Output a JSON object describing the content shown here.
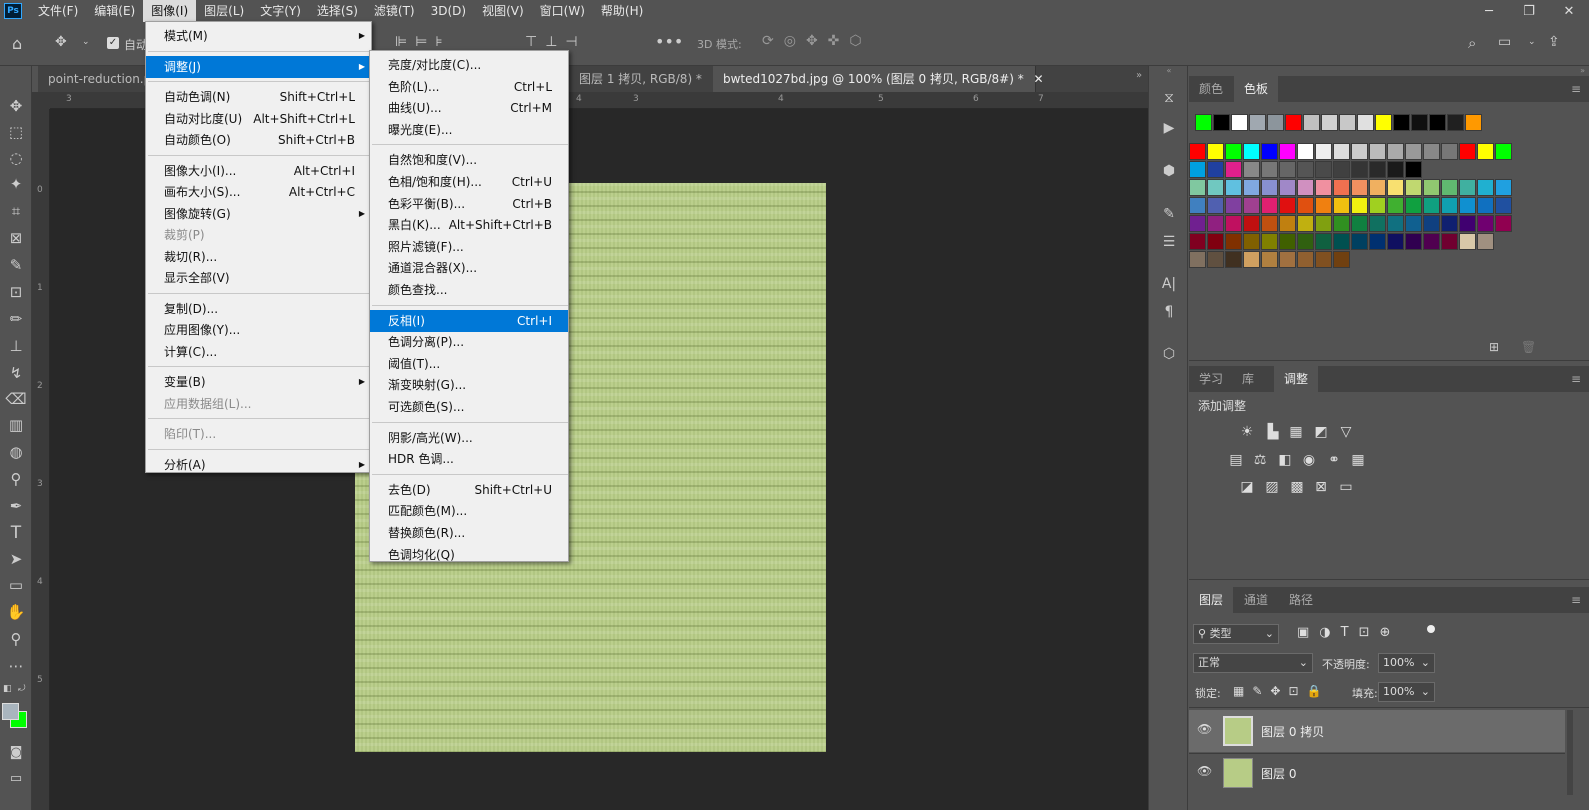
{
  "app": {
    "logo": "Ps"
  },
  "menubar": {
    "items": [
      "文件(F)",
      "编辑(E)",
      "图像(I)",
      "图层(L)",
      "文字(Y)",
      "选择(S)",
      "滤镜(T)",
      "3D(D)",
      "视图(V)",
      "窗口(W)",
      "帮助(H)"
    ],
    "active_index": 2
  },
  "options_bar": {
    "auto_select_label": "自动",
    "mode_3d_label": "3D 模式:"
  },
  "tabs": [
    {
      "label": "point-reduction.p",
      "active": false
    },
    {
      "label": "图层 1 拷贝, RGB/8) *",
      "active": false
    },
    {
      "label": "bwted1027bd.jpg @ 100% (图层 0 拷贝, RGB/8#) *",
      "active": true
    }
  ],
  "ruler": {
    "top": [
      "3",
      "4",
      "5",
      "6",
      "7"
    ],
    "top_visible": [
      "3",
      "4",
      "3",
      "4",
      "5",
      "6",
      "7"
    ],
    "left": [
      "0",
      "1",
      "2",
      "3",
      "4",
      "5"
    ]
  },
  "image_menu": {
    "items": [
      {
        "label": "模式(M)",
        "shortcut": "",
        "submenu": true,
        "disabled": false
      },
      {
        "separator": true
      },
      {
        "label": "调整(J)",
        "shortcut": "",
        "submenu": true,
        "disabled": false,
        "highlighted": true
      },
      {
        "separator": true
      },
      {
        "label": "自动色调(N)",
        "shortcut": "Shift+Ctrl+L"
      },
      {
        "label": "自动对比度(U)",
        "shortcut": "Alt+Shift+Ctrl+L"
      },
      {
        "label": "自动颜色(O)",
        "shortcut": "Shift+Ctrl+B"
      },
      {
        "separator": true
      },
      {
        "label": "图像大小(I)...",
        "shortcut": "Alt+Ctrl+I"
      },
      {
        "label": "画布大小(S)...",
        "shortcut": "Alt+Ctrl+C"
      },
      {
        "label": "图像旋转(G)",
        "shortcut": "",
        "submenu": true
      },
      {
        "label": "裁剪(P)",
        "shortcut": "",
        "disabled": true
      },
      {
        "label": "裁切(R)...",
        "shortcut": ""
      },
      {
        "label": "显示全部(V)",
        "shortcut": ""
      },
      {
        "separator": true
      },
      {
        "label": "复制(D)...",
        "shortcut": ""
      },
      {
        "label": "应用图像(Y)...",
        "shortcut": ""
      },
      {
        "label": "计算(C)...",
        "shortcut": ""
      },
      {
        "separator": true
      },
      {
        "label": "变量(B)",
        "shortcut": "",
        "submenu": true
      },
      {
        "label": "应用数据组(L)...",
        "shortcut": "",
        "disabled": true
      },
      {
        "separator": true
      },
      {
        "label": "陷印(T)...",
        "shortcut": "",
        "disabled": true
      },
      {
        "separator": true
      },
      {
        "label": "分析(A)",
        "shortcut": "",
        "submenu": true
      }
    ]
  },
  "adjust_menu": {
    "items": [
      {
        "label": "亮度/对比度(C)...",
        "shortcut": ""
      },
      {
        "label": "色阶(L)...",
        "shortcut": "Ctrl+L"
      },
      {
        "label": "曲线(U)...",
        "shortcut": "Ctrl+M"
      },
      {
        "label": "曝光度(E)...",
        "shortcut": ""
      },
      {
        "separator": true
      },
      {
        "label": "自然饱和度(V)...",
        "shortcut": ""
      },
      {
        "label": "色相/饱和度(H)...",
        "shortcut": "Ctrl+U"
      },
      {
        "label": "色彩平衡(B)...",
        "shortcut": "Ctrl+B"
      },
      {
        "label": "黑白(K)...",
        "shortcut": "Alt+Shift+Ctrl+B"
      },
      {
        "label": "照片滤镜(F)...",
        "shortcut": ""
      },
      {
        "label": "通道混合器(X)...",
        "shortcut": ""
      },
      {
        "label": "颜色查找...",
        "shortcut": ""
      },
      {
        "separator": true
      },
      {
        "label": "反相(I)",
        "shortcut": "Ctrl+I",
        "highlighted": true
      },
      {
        "label": "色调分离(P)...",
        "shortcut": ""
      },
      {
        "label": "阈值(T)...",
        "shortcut": ""
      },
      {
        "label": "渐变映射(G)...",
        "shortcut": ""
      },
      {
        "label": "可选颜色(S)...",
        "shortcut": ""
      },
      {
        "separator": true
      },
      {
        "label": "阴影/高光(W)...",
        "shortcut": ""
      },
      {
        "label": "HDR 色调...",
        "shortcut": ""
      },
      {
        "separator": true
      },
      {
        "label": "去色(D)",
        "shortcut": "Shift+Ctrl+U"
      },
      {
        "label": "匹配颜色(M)...",
        "shortcut": ""
      },
      {
        "label": "替换颜色(R)...",
        "shortcut": ""
      },
      {
        "label": "色调均化(Q)",
        "shortcut": ""
      }
    ]
  },
  "swatches_panel": {
    "tabs": [
      "颜色",
      "色板"
    ],
    "active_tab": 1,
    "recent": [
      "#00ff00",
      "#000000",
      "#ffffff",
      "#a0a8b0",
      "#8c959c",
      "#ff0000",
      "#c0c0c0",
      "#d0d0d0",
      "#c8c8c8",
      "#e0e0e0",
      "#ffff00",
      "#000000",
      "#101010",
      "#000000",
      "#202020",
      "#ff9900"
    ],
    "rows": [
      [
        "#ff0000",
        "#ffff00",
        "#00ff00",
        "#00ffff",
        "#0000ff",
        "#ff00ff",
        "#ffffff",
        "#eeeeee",
        "#dddddd",
        "#cccccc",
        "#bbbbbb",
        "#aaaaaa",
        "#999999",
        "#888888",
        "#777777",
        "#ff0000",
        "#ffff00",
        "#00ff00"
      ],
      [
        "#00a0e0",
        "#2040a0",
        "#e0208c",
        "#888888",
        "#777777",
        "#666666",
        "#555555",
        "#4a4a4a",
        "#404040",
        "#353535",
        "#2a2a2a",
        "#1a1a1a",
        "#000000"
      ],
      [
        "#80c8a0",
        "#70c8c0",
        "#60c0e0",
        "#80a8e0",
        "#8890d0",
        "#a088c8",
        "#d090c0",
        "#f090a0",
        "#f07050",
        "#f09060",
        "#f0b060",
        "#f8e070",
        "#c0d870",
        "#90c870",
        "#60b870",
        "#40b0a0",
        "#20b0d0",
        "#20a0e0"
      ],
      [
        "#4080c0",
        "#5060b0",
        "#8040a0",
        "#a04090",
        "#e02070",
        "#e01010",
        "#e05010",
        "#f08010",
        "#f0c010",
        "#f0f010",
        "#a0d020",
        "#40b030",
        "#10a040",
        "#10a080",
        "#10a0b0",
        "#1090d0",
        "#1070c0",
        "#2050a0"
      ],
      [
        "#702090",
        "#902080",
        "#c01060",
        "#c01010",
        "#c05010",
        "#c08010",
        "#c0b010",
        "#80a010",
        "#309020",
        "#108040",
        "#107060",
        "#107080",
        "#106090",
        "#104080",
        "#102070",
        "#400070",
        "#700070",
        "#900050"
      ],
      [
        "#800020",
        "#800010",
        "#803000",
        "#806000",
        "#808000",
        "#406000",
        "#306010",
        "#106040",
        "#005050",
        "#004060",
        "#003070",
        "#101060",
        "#300050",
        "#500050",
        "#700030",
        "#d8c8a8",
        "#a09080"
      ],
      [
        "#807060",
        "#605040",
        "#403020",
        "#d0a060",
        "#b08040",
        "#a07040",
        "#906030",
        "#805020",
        "#704010"
      ]
    ]
  },
  "adjustments_panel": {
    "tabs": [
      "学习",
      "库",
      "调整"
    ],
    "active_tab": 2,
    "title": "添加调整"
  },
  "layers_panel": {
    "tabs": [
      "图层",
      "通道",
      "路径"
    ],
    "active_tab": 0,
    "filter_label": "类型",
    "blend_mode": "正常",
    "opacity_label": "不透明度:",
    "opacity_value": "100%",
    "lock_label": "锁定:",
    "fill_label": "填充:",
    "fill_value": "100%",
    "layers": [
      {
        "name": "图层 0 拷贝",
        "visible": true,
        "selected": true
      },
      {
        "name": "图层 0",
        "visible": true,
        "selected": false
      }
    ]
  },
  "colors": {
    "fg": "#a9b5be",
    "bg": "#00ff00",
    "document": "#b7cc86"
  }
}
